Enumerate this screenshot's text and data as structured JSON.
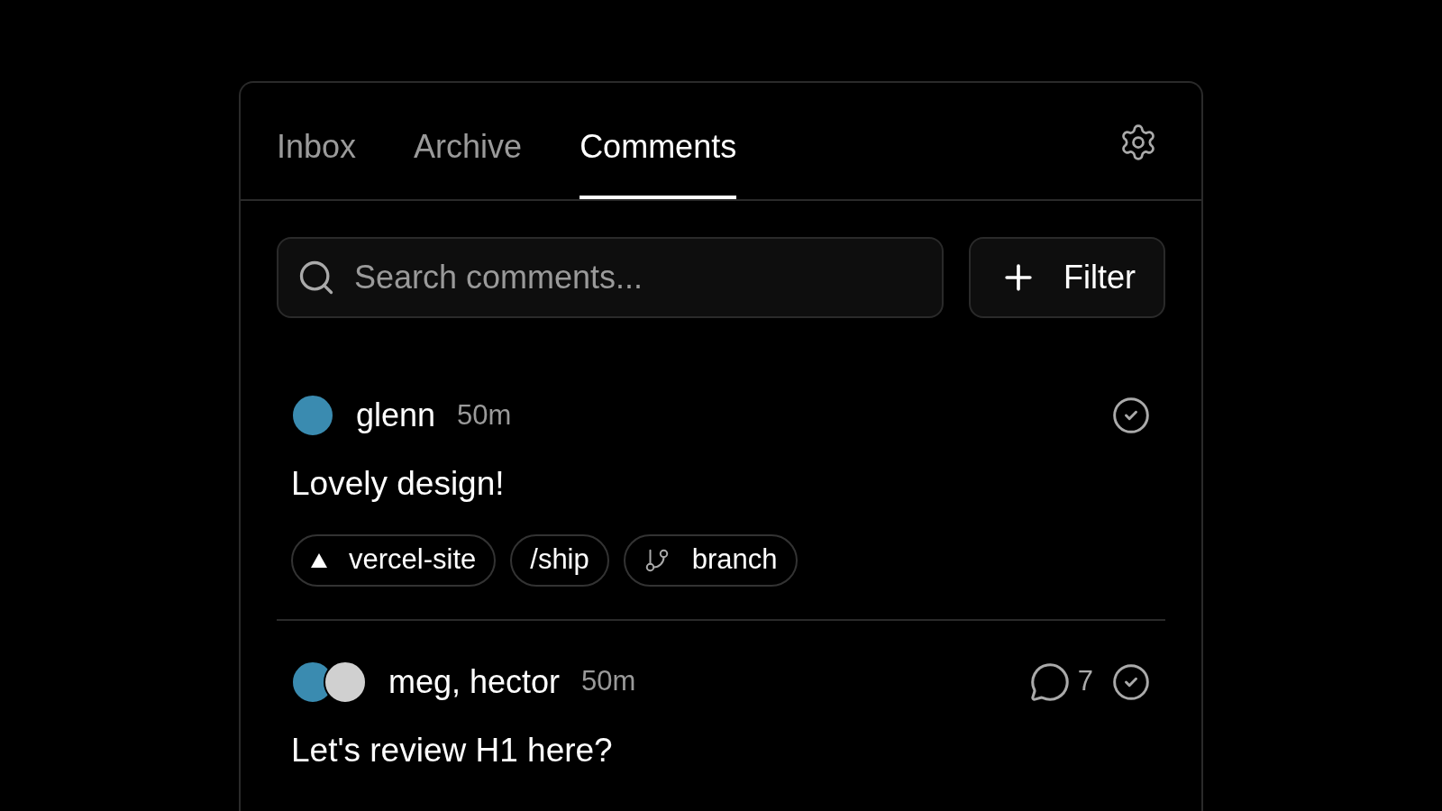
{
  "tabs": [
    {
      "label": "Inbox",
      "selected": false
    },
    {
      "label": "Archive",
      "selected": false
    },
    {
      "label": "Comments",
      "selected": true
    }
  ],
  "search": {
    "placeholder": "Search comments..."
  },
  "filter_button": {
    "label": "Filter"
  },
  "comments": [
    {
      "authors": "glenn",
      "avatars": [
        {
          "kind": "photo"
        }
      ],
      "time": "50m",
      "body": "Lovely design!",
      "tags": [
        {
          "kind": "project",
          "label": "vercel-site"
        },
        {
          "kind": "path",
          "label": "/ship"
        },
        {
          "kind": "branch",
          "label": "branch"
        }
      ]
    },
    {
      "authors": "meg, hector",
      "avatars": [
        {
          "kind": "photo"
        },
        {
          "kind": "photo"
        }
      ],
      "time": "50m",
      "replies": "7",
      "body": "Let's review H1 here?"
    }
  ]
}
